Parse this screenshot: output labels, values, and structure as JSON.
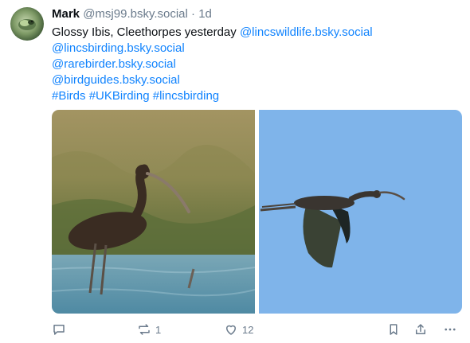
{
  "post": {
    "author_name": "Mark",
    "handle": "@msj99.bsky.social",
    "separator": "·",
    "time": "1d",
    "text_plain": "Glossy Ibis, Cleethorpes yesterday",
    "mentions": [
      "@lincswildlife.bsky.social",
      "@lincsbirding.bsky.social",
      "@rarebirder.bsky.social",
      "@birdguides.bsky.social"
    ],
    "hashtags": [
      "#Birds",
      "#UKBirding",
      "#lincsbirding"
    ],
    "images": [
      {
        "icon": "wading-ibis-photo"
      },
      {
        "icon": "flying-ibis-photo"
      }
    ]
  },
  "actions": {
    "reply_count": "",
    "repost_count": "1",
    "like_count": "12"
  },
  "colors": {
    "link": "#1083fe",
    "muted": "#6b7b8c",
    "text": "#0b0f14",
    "sky": "#7fb4ea"
  }
}
